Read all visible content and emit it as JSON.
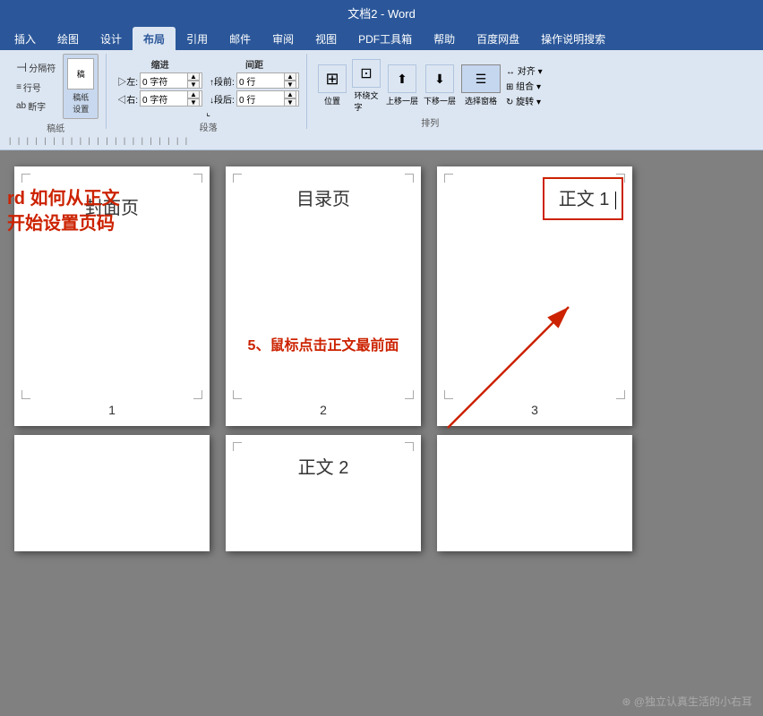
{
  "titlebar": {
    "text": "文档2 - Word"
  },
  "ribbon": {
    "tabs": [
      {
        "label": "插入",
        "active": false
      },
      {
        "label": "绘图",
        "active": false
      },
      {
        "label": "设计",
        "active": false
      },
      {
        "label": "布局",
        "active": true
      },
      {
        "label": "引用",
        "active": false
      },
      {
        "label": "邮件",
        "active": false
      },
      {
        "label": "审阅",
        "active": false
      },
      {
        "label": "视图",
        "active": false
      },
      {
        "label": "PDF工具箱",
        "active": false
      },
      {
        "label": "帮助",
        "active": false
      },
      {
        "label": "百度网盘",
        "active": false
      },
      {
        "label": "操作说明搜索",
        "active": false
      }
    ],
    "groups": {
      "drafting": {
        "label": "稿纸",
        "buttons": [
          "分隔符",
          "行号",
          "断字"
        ]
      },
      "indent": {
        "label": "段落",
        "left_label": "左:",
        "left_value": "0 字符",
        "right_label": "右:",
        "right_value": "0 字符",
        "before_label": "段前:",
        "before_value": "0 行",
        "after_label": "段后:",
        "after_value": "0 行"
      },
      "arrange": {
        "label": "排列",
        "buttons": [
          "位置",
          "环绕文",
          "上移一层",
          "下移一层",
          "选择窗格",
          "对齐",
          "组合",
          "旋转"
        ]
      }
    }
  },
  "pages": {
    "page1": {
      "content": "封面页",
      "number": "1"
    },
    "page2": {
      "content": "目录页",
      "number": "2"
    },
    "page3": {
      "content": "正文 1",
      "number": "3"
    },
    "page4": {
      "content": "正文 2",
      "number": ""
    }
  },
  "annotations": {
    "left_text_line1": "rd 如何从正文",
    "left_text_line2": "开始设置页码",
    "arrow_text": "5、鼠标点击正文最前面"
  },
  "brand": {
    "text": "⊛ @独立认真生活的小右耳"
  }
}
